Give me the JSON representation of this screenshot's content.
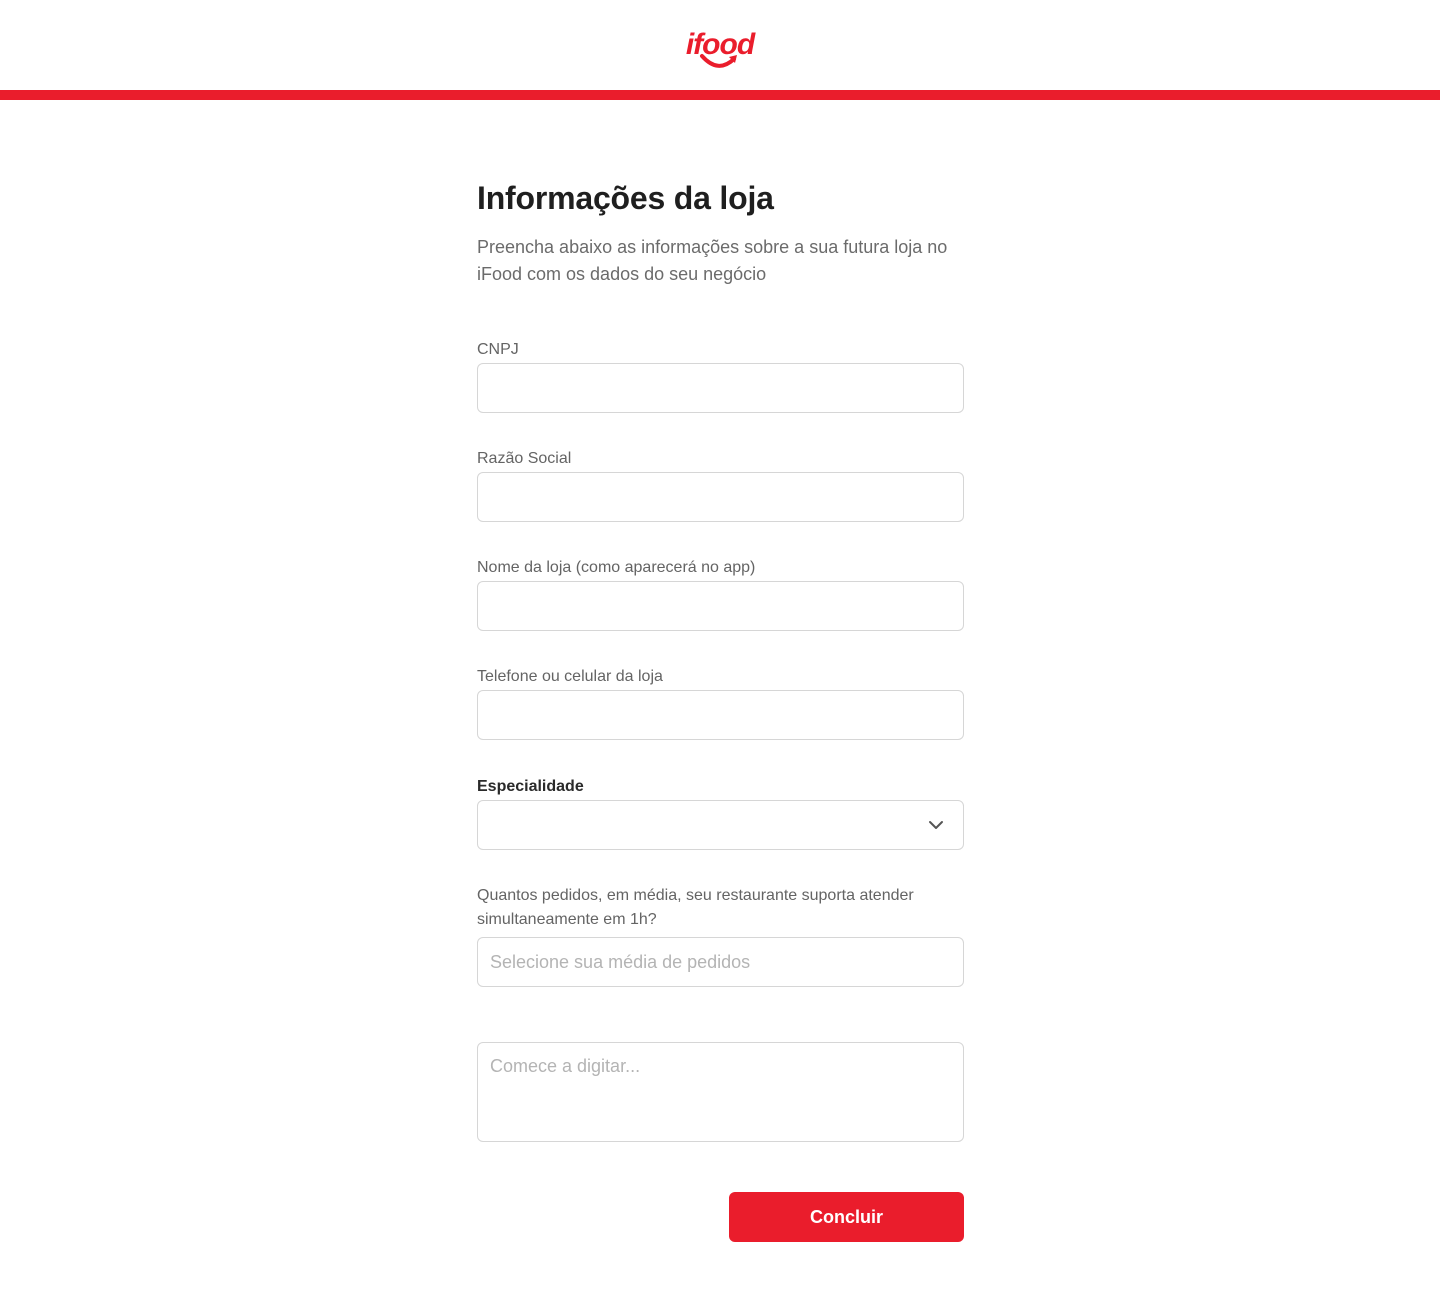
{
  "header": {
    "logo_text": "ifood",
    "brand_color": "#ea1d2c"
  },
  "page": {
    "title": "Informações da loja",
    "subtitle": "Preencha abaixo as informações sobre a sua futura loja no iFood com os dados do seu negócio"
  },
  "form": {
    "cnpj": {
      "label": "CNPJ",
      "value": ""
    },
    "razao_social": {
      "label": "Razão Social",
      "value": ""
    },
    "nome_loja": {
      "label": "Nome da loja (como aparecerá no app)",
      "value": ""
    },
    "telefone": {
      "label": "Telefone ou celular da loja",
      "value": ""
    },
    "especialidade": {
      "label": "Especialidade",
      "value": "",
      "icon": "chevron-down-icon"
    },
    "pedidos": {
      "label": "Quantos pedidos, em média, seu restaurante suporta atender simultaneamente em 1h?",
      "placeholder": "Selecione sua média de pedidos"
    },
    "texto": {
      "placeholder": "Comece a digitar..."
    },
    "submit_label": "Concluir"
  }
}
